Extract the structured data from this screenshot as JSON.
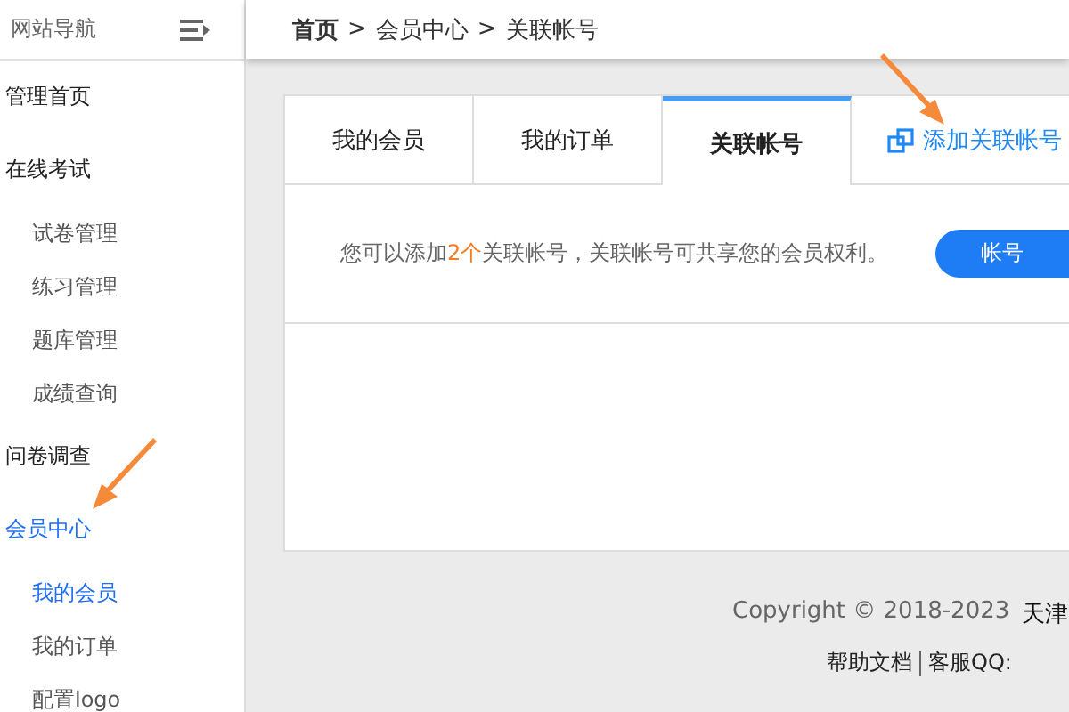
{
  "sidebar": {
    "title": "网站导航",
    "items": [
      {
        "label": "管理首页",
        "selected": false
      },
      {
        "label": "在线考试",
        "selected": false,
        "children": [
          {
            "label": "试卷管理",
            "selected": false
          },
          {
            "label": "练习管理",
            "selected": false
          },
          {
            "label": "题库管理",
            "selected": false
          },
          {
            "label": "成绩查询",
            "selected": false
          }
        ]
      },
      {
        "label": "问卷调查",
        "selected": false
      },
      {
        "label": "会员中心",
        "selected": true,
        "children": [
          {
            "label": "我的会员",
            "selected": true
          },
          {
            "label": "我的订单",
            "selected": false
          },
          {
            "label": "配置logo",
            "selected": false
          }
        ]
      }
    ]
  },
  "breadcrumb": [
    "首页",
    "会员中心",
    "关联帐号"
  ],
  "breadcrumb_separators": [
    ">",
    ">"
  ],
  "tabs": [
    {
      "label": "我的会员",
      "selected": false
    },
    {
      "label": "我的订单",
      "selected": false
    },
    {
      "label": "关联帐号",
      "selected": true
    }
  ],
  "add_link": "添加关联帐号",
  "notice": "您可以添加**2个**关联帐号，关联帐号可共享您的会员权利。",
  "notice_button": "帐号",
  "footer": {
    "copyright": "Copyright © 2018-2023",
    "company": "天津",
    "links": [
      "帮助文档",
      "客服QQ:"
    ]
  }
}
